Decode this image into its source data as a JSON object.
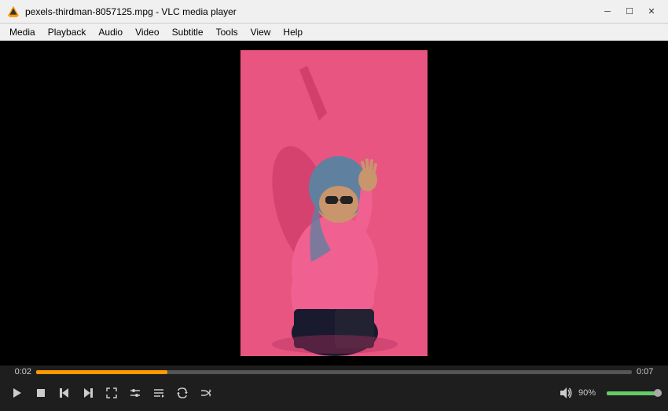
{
  "titlebar": {
    "title": "pexels-thirdman-8057125.mpg - VLC media player",
    "logo": "vlc-logo",
    "minimize_label": "─",
    "maximize_label": "☐",
    "close_label": "✕"
  },
  "menubar": {
    "items": [
      {
        "label": "Media",
        "id": "media"
      },
      {
        "label": "Playback",
        "id": "playback"
      },
      {
        "label": "Audio",
        "id": "audio"
      },
      {
        "label": "Video",
        "id": "video"
      },
      {
        "label": "Subtitle",
        "id": "subtitle"
      },
      {
        "label": "Tools",
        "id": "tools"
      },
      {
        "label": "View",
        "id": "view"
      },
      {
        "label": "Help",
        "id": "help"
      }
    ]
  },
  "player": {
    "time_current": "0:02",
    "time_total": "0:07",
    "progress_pct": 22,
    "volume_pct": "90%",
    "volume_fill_pct": 90
  },
  "controls": {
    "play_pause": "play",
    "stop": "stop",
    "prev": "prev",
    "next": "next",
    "fullscreen": "fullscreen",
    "toggle_controls": "toggle",
    "playlist": "playlist",
    "loop": "loop",
    "random": "random"
  }
}
